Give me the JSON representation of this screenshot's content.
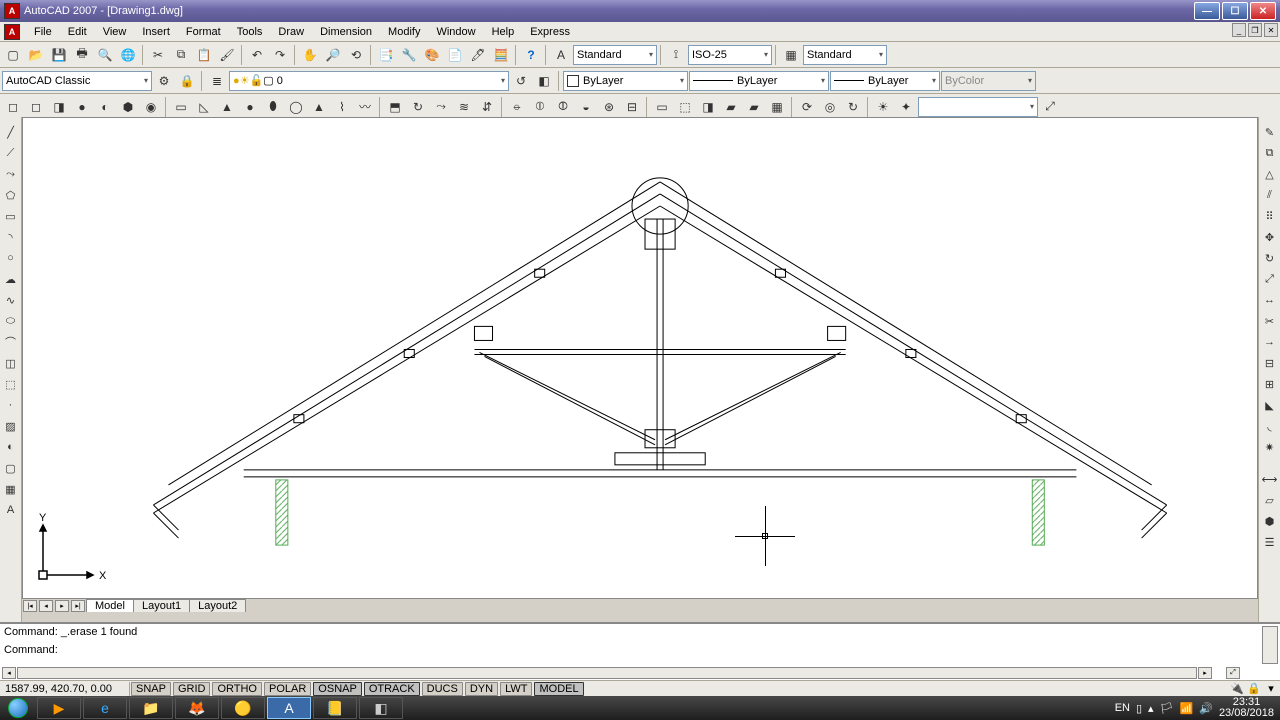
{
  "title": "AutoCAD 2007 - [Drawing1.dwg]",
  "menus": [
    "File",
    "Edit",
    "View",
    "Insert",
    "Format",
    "Tools",
    "Draw",
    "Dimension",
    "Modify",
    "Window",
    "Help",
    "Express"
  ],
  "row1": {
    "text_style": "Standard",
    "dim_style": "ISO-25",
    "table_style": "Standard"
  },
  "row2": {
    "workspace": "AutoCAD Classic",
    "layer": "0",
    "color": "ByLayer",
    "linetype": "ByLayer",
    "lineweight": "ByLayer",
    "plotstyle": "ByColor"
  },
  "layout_tabs": {
    "model": "Model",
    "l1": "Layout1",
    "l2": "Layout2"
  },
  "command_history": "Command: _.erase 1 found",
  "command_prompt": "Command:",
  "coords": "1587.99, 420.70, 0.00",
  "status_toggles": [
    "SNAP",
    "GRID",
    "ORTHO",
    "POLAR",
    "OSNAP",
    "OTRACK",
    "DUCS",
    "DYN",
    "LWT",
    "MODEL"
  ],
  "status_active": [
    "OSNAP",
    "OTRACK",
    "MODEL"
  ],
  "lang": "EN",
  "time": "23:31",
  "date": "23/08/2018",
  "ucs": {
    "x": "X",
    "y": "Y"
  }
}
